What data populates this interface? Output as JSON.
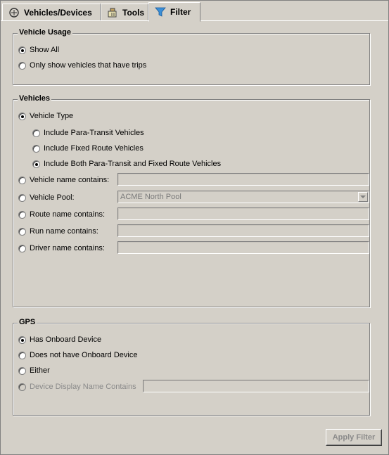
{
  "tabs": [
    {
      "label": "Vehicles/Devices",
      "icon": "vehicles-icon"
    },
    {
      "label": "Tools",
      "icon": "tools-icon"
    },
    {
      "label": "Filter",
      "icon": "filter-icon"
    }
  ],
  "vehicle_usage": {
    "title": "Vehicle Usage",
    "show_all": "Show All",
    "only_trips": "Only show vehicles that have trips"
  },
  "vehicles": {
    "title": "Vehicles",
    "vehicle_type": "Vehicle Type",
    "para_transit": "Include Para-Transit Vehicles",
    "fixed_route": "Include Fixed Route Vehicles",
    "both": "Include Both Para-Transit and Fixed Route Vehicles",
    "name_contains": "Vehicle name contains:",
    "pool": "Vehicle Pool:",
    "pool_value": "ACME North Pool",
    "route_contains": "Route name contains:",
    "run_contains": "Run name contains:",
    "driver_contains": "Driver name contains:"
  },
  "gps": {
    "title": "GPS",
    "has_device": "Has Onboard Device",
    "no_device": "Does not have Onboard Device",
    "either": "Either",
    "display_name": "Device Display Name Contains"
  },
  "apply_button": "Apply Filter"
}
